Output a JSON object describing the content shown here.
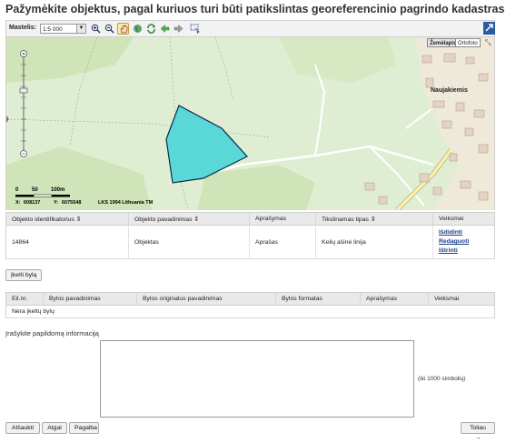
{
  "page": {
    "title": "Pažymėkite objektus, pagal kuriuos turi būti patikslintas georeferencinio pagrindo kadastras"
  },
  "toolbar": {
    "scale_label": "Mastelis:",
    "scale_value": "1:5 000",
    "tools": [
      "zoom-in-icon",
      "zoom-out-icon",
      "pan-hand-icon",
      "globe-icon",
      "refresh-icon",
      "back-arrow-icon",
      "forward-arrow-icon",
      "select-area-icon"
    ],
    "expand_icon": "expand-icon"
  },
  "map": {
    "layer_buttons": [
      "Žemėlapis",
      "Ortofoto"
    ],
    "selected_layer": "Žemėlapis",
    "place_name": "Naujakiemis",
    "scalebar": {
      "labels": [
        "0",
        "50",
        "100m"
      ]
    },
    "coords": {
      "x_label": "X:",
      "x_value": "608137",
      "y_label": "Y:",
      "y_value": "6075548",
      "crs": "LKS 1994 Lithuania TM"
    },
    "colors": {
      "background": "#dfeed3",
      "forest": "#c9e0b0",
      "polygon": "#5ad7d7",
      "road": "#f4efb6"
    }
  },
  "objects_table": {
    "headers": [
      "Objekto identifikatorius",
      "Objekto pavadinimas",
      "Aprašymas",
      "Tikslinamas tipas",
      "Veiksmai"
    ],
    "sortable": [
      true,
      true,
      false,
      true,
      false
    ],
    "rows": [
      {
        "id": "14864",
        "name": "Objektas",
        "description": "Aprašas",
        "type": "Kelių ašinė linija",
        "actions": [
          "Išdidinti",
          "Redaguoti",
          "Ištrinti"
        ]
      }
    ]
  },
  "upload": {
    "button_label": "Įkelti bylą"
  },
  "files_table": {
    "headers": [
      "Eil.nr.",
      "Bylos pavadinimas",
      "Bylos originalus pavadinimas",
      "Bylos formatas",
      "Aprašymas",
      "Veiksmai"
    ],
    "empty_text": "Nėra įkeltų bylų"
  },
  "additional_info": {
    "label": "Įrašykite papildomą informaciją",
    "value": "",
    "limit_hint": "(iki 1000 simbolių)"
  },
  "footer": {
    "cancel": "Atšaukti",
    "back": "Atgal",
    "help": "Pagalba",
    "next": "Toliau"
  }
}
